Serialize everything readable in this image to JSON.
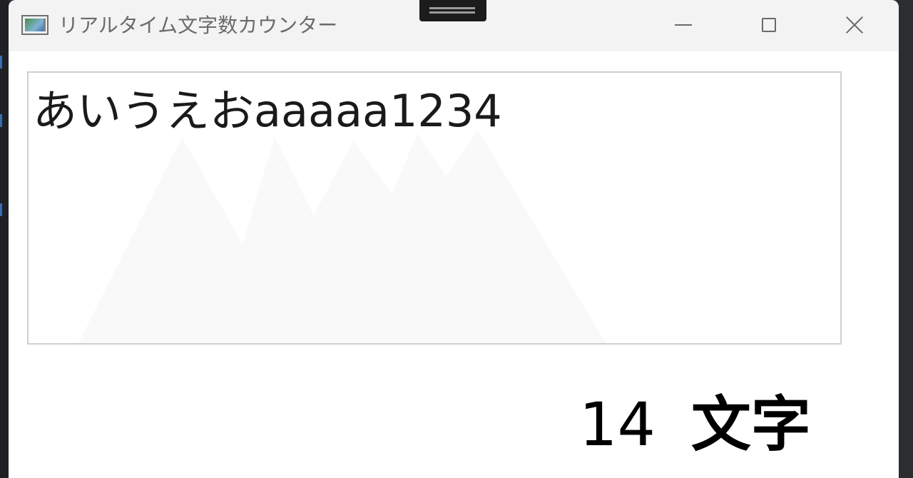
{
  "window": {
    "title": "リアルタイム文字数カウンター",
    "icon": "app-window-icon",
    "controls": {
      "minimize_icon": "minimize-icon",
      "maximize_icon": "maximize-icon",
      "close_icon": "close-icon"
    }
  },
  "input": {
    "value": "あいうえおaaaaa1234"
  },
  "counter": {
    "count": "14",
    "unit": "文字"
  },
  "colors": {
    "titlebar": "#f3f3f3",
    "window_bg": "#ffffff",
    "textbox_border": "#cfcfcf",
    "text": "#1a1a1a",
    "title_text": "#6a6a6a"
  }
}
